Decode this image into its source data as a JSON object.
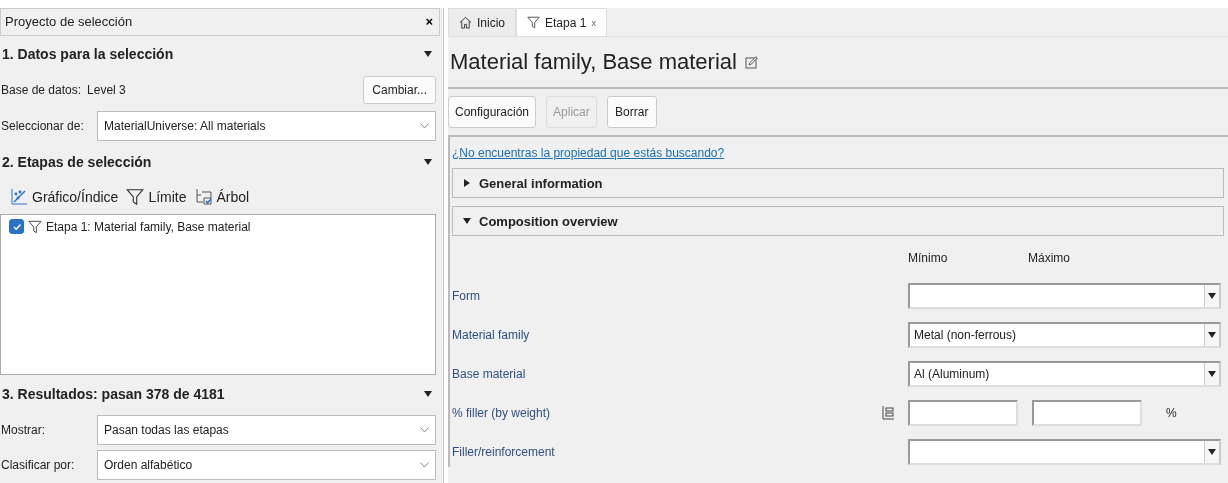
{
  "left_panel": {
    "title": "Proyecto de selección",
    "close": "×",
    "section_1": {
      "title": "1. Datos para la selección",
      "expanded": true,
      "database_label": "Base de datos:",
      "database_value": "Level 3",
      "change_button": "Cambiar...",
      "select_from_label": "Seleccionar de:",
      "select_from_value": "MaterialUniverse: All materials"
    },
    "section_2": {
      "title": "2. Etapas de selección",
      "expanded": true,
      "tools": [
        {
          "kind": "chart",
          "label": "Gráfico/Índice"
        },
        {
          "kind": "limit",
          "label": "Límite"
        },
        {
          "kind": "tree",
          "label": "Árbol"
        }
      ],
      "stages": [
        {
          "label": "Etapa 1: Material family, Base material",
          "checked": true
        }
      ]
    },
    "section_3": {
      "title": "3. Resultados: pasan 378 de 4181",
      "expanded": true,
      "fields": [
        {
          "label": "Mostrar:",
          "value": "Pasan todas las etapas"
        },
        {
          "label": "Clasificar por:",
          "value": "Orden alfabético"
        }
      ]
    }
  },
  "tabs": [
    {
      "kind": "home",
      "label": "Inicio",
      "selected": false
    },
    {
      "kind": "limit",
      "label": "Etapa 1",
      "selected": true,
      "close": "x"
    }
  ],
  "stage": {
    "title": "Material family, Base material",
    "buttons": [
      {
        "label": "Configuración",
        "disabled": false
      },
      {
        "label": "Aplicar",
        "disabled": true
      },
      {
        "label": "Borrar",
        "disabled": false
      }
    ],
    "link": "¿No encuentras la propiedad que estás buscando?",
    "groups": [
      {
        "title": "General information",
        "expanded": false
      },
      {
        "title": "Composition overview",
        "expanded": true
      }
    ],
    "columns": [
      "Mínimo",
      "Máximo"
    ],
    "properties": [
      {
        "kind": "dropdown",
        "label": "Form"
      },
      {
        "kind": "dropdown",
        "label": "Material family",
        "value": "Metal (non-ferrous)"
      },
      {
        "kind": "dropdown",
        "label": "Base material",
        "value": "Al (Aluminum)"
      },
      {
        "kind": "range",
        "label": "% filler (by weight)",
        "unit": "%"
      },
      {
        "kind": "dropdown",
        "label": "Filler/reinforcement"
      }
    ]
  }
}
